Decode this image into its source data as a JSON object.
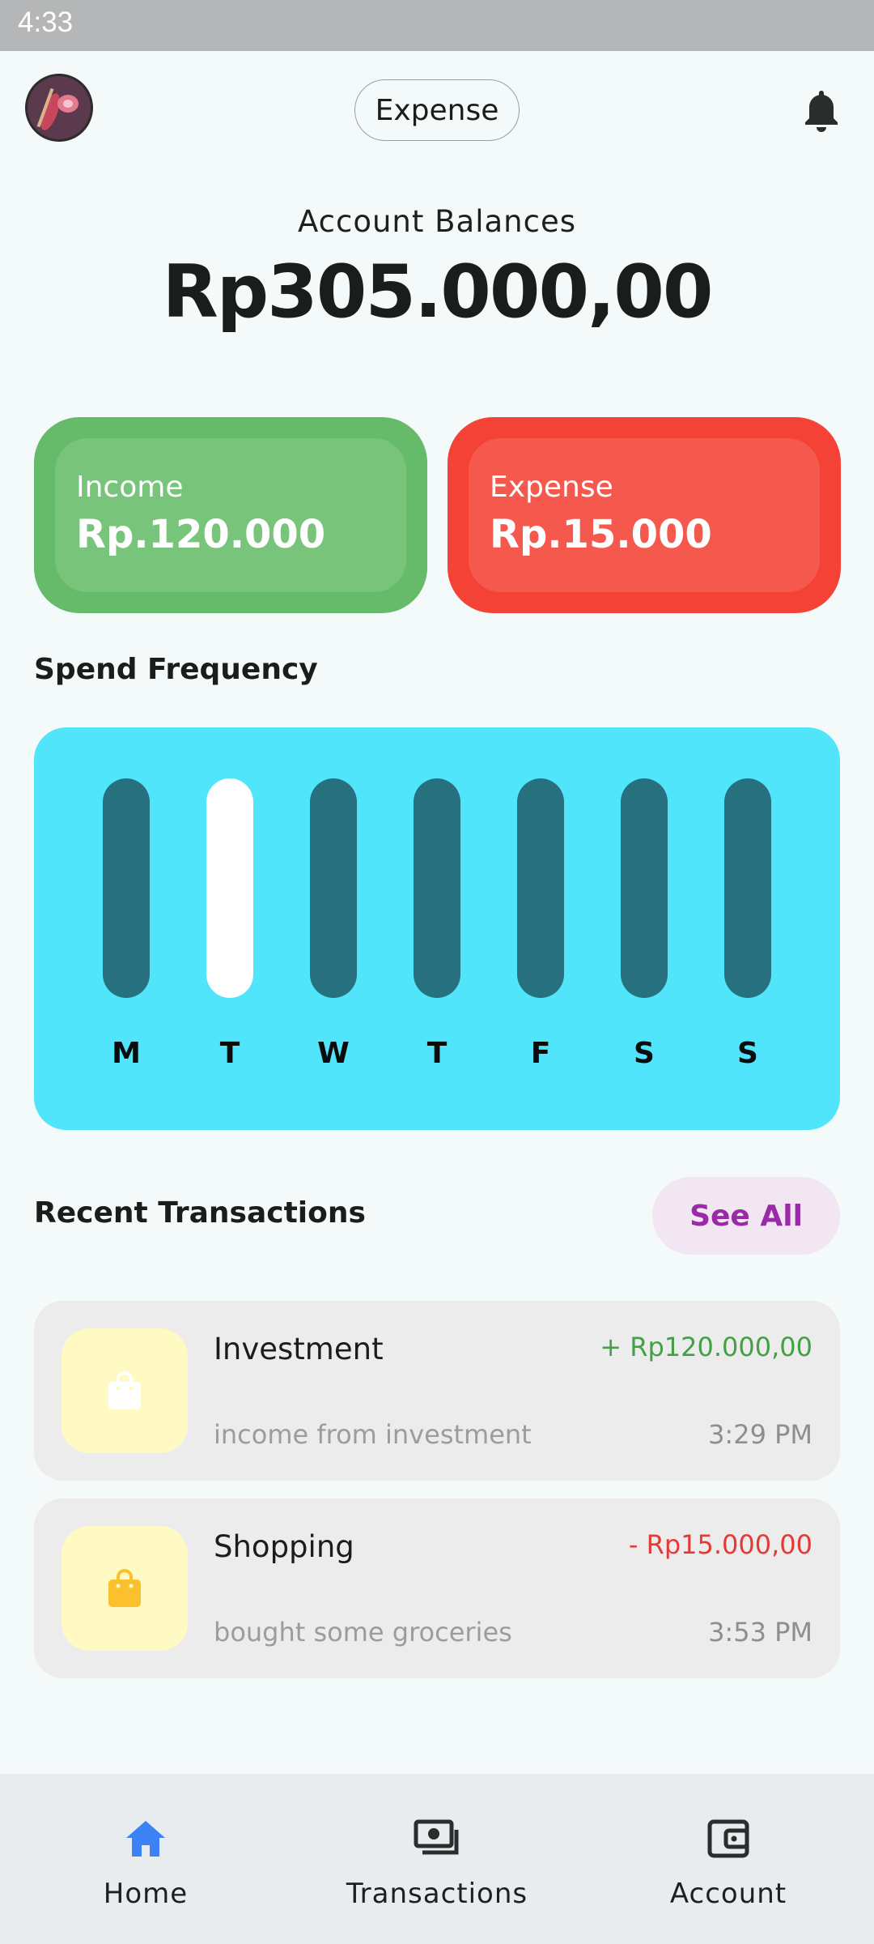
{
  "status_bar": {
    "time": "4:33"
  },
  "header": {
    "mode_pill": "Expense"
  },
  "balance": {
    "label": "Account Balances",
    "value": "Rp305.000,00"
  },
  "cards": {
    "income": {
      "label": "Income",
      "amount": "Rp.120.000"
    },
    "expense": {
      "label": "Expense",
      "amount": "Rp.15.000"
    }
  },
  "spend_frequency": {
    "title": "Spend Frequency",
    "days": [
      "M",
      "T",
      "W",
      "T",
      "F",
      "S",
      "S"
    ],
    "highlighted_index": 1
  },
  "recent": {
    "title": "Recent Transactions",
    "see_all": "See All",
    "items": [
      {
        "title": "Investment",
        "desc": "income from investment",
        "amount": "+ Rp120.000,00",
        "time": "3:29 PM",
        "amount_color": "#43a047",
        "icon_color": "#ffffff",
        "icon": "shopping-bag-icon"
      },
      {
        "title": "Shopping",
        "desc": "bought some groceries",
        "amount": "- Rp15.000,00",
        "time": "3:53 PM",
        "amount_color": "#e53935",
        "icon_color": "#fbc02d",
        "icon": "shopping-bag-icon"
      }
    ]
  },
  "nav": {
    "items": [
      {
        "label": "Home",
        "icon": "home-icon",
        "active": true
      },
      {
        "label": "Transactions",
        "icon": "money-icon",
        "active": false
      },
      {
        "label": "Account",
        "icon": "wallet-icon",
        "active": false
      }
    ]
  },
  "colors": {
    "income": "#66bb6a",
    "expense": "#f44336",
    "chart_bg": "#51e5fc",
    "bar": "#27707e",
    "bar_active": "#ffffff",
    "accent": "#9a2aa8",
    "nav_active": "#3b82f6"
  }
}
